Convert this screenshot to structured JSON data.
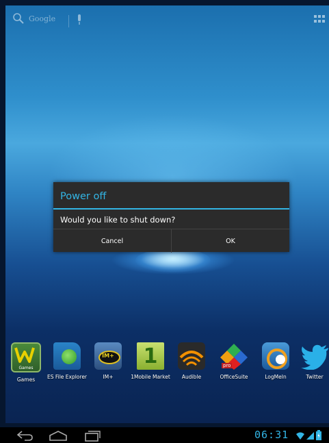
{
  "search": {
    "label": "Google",
    "icon": "search-icon"
  },
  "dialog": {
    "title": "Power off",
    "message": "Would you like to shut down?",
    "cancel_label": "Cancel",
    "ok_label": "OK"
  },
  "dock": {
    "apps": [
      {
        "label": "Games",
        "badge": "Games",
        "icon": "games-icon"
      },
      {
        "label": "ES File Explorer",
        "icon": "es-file-explorer-icon"
      },
      {
        "label": "IM+",
        "badge": "IM+",
        "icon": "im-plus-icon"
      },
      {
        "label": "1Mobile Market",
        "badge": "1",
        "icon": "1mobile-market-icon"
      },
      {
        "label": "Audible",
        "icon": "audible-icon"
      },
      {
        "label": "OfficeSuite",
        "badge": "pro",
        "icon": "officesuite-icon"
      },
      {
        "label": "LogMeIn",
        "icon": "logmein-icon"
      },
      {
        "label": "Twitter",
        "icon": "twitter-icon"
      }
    ]
  },
  "status": {
    "time": "06:31"
  },
  "colors": {
    "accent": "#33b5e5",
    "dialog_bg": "#2b2b2b"
  }
}
